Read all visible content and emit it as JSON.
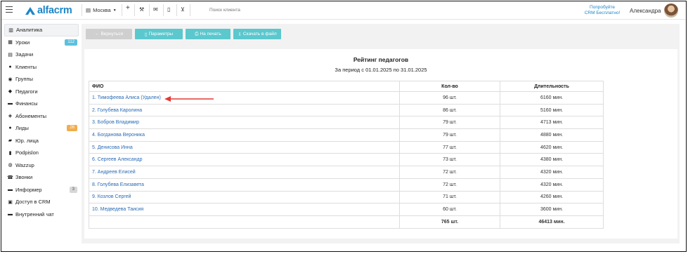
{
  "topbar": {
    "logo_text": "alfacrm",
    "branch": "Москва",
    "search_placeholder": "Поиск клиента",
    "promo_line1": "Попробуйте",
    "promo_line2": "CRM Бесплатно!",
    "user_name": "Александра"
  },
  "sidebar": {
    "items": [
      {
        "label": "Аналитика",
        "icon": "chart-icon"
      },
      {
        "label": "Уроки",
        "icon": "calendar-icon",
        "badge": "112"
      },
      {
        "label": "Задачи",
        "icon": "tasks-icon"
      },
      {
        "label": "Клиенты",
        "icon": "user-icon"
      },
      {
        "label": "Группы",
        "icon": "users-icon"
      },
      {
        "label": "Педагоги",
        "icon": "graduation-icon"
      },
      {
        "label": "Финансы",
        "icon": "money-icon"
      },
      {
        "label": "Абонементы",
        "icon": "tag-icon"
      },
      {
        "label": "Лиды",
        "icon": "user-plus-icon",
        "badge": "26"
      },
      {
        "label": "Юр. лица",
        "icon": "briefcase-icon"
      },
      {
        "label": "Podpislon",
        "icon": "file-icon"
      },
      {
        "label": "Wazzup",
        "icon": "whatsapp-icon"
      },
      {
        "label": "Звонки",
        "icon": "phone-icon"
      },
      {
        "label": "Информер",
        "icon": "bell-icon",
        "badge": "3"
      },
      {
        "label": "Доступ в CRM",
        "icon": "lock-icon"
      },
      {
        "label": "Внутренний чат",
        "icon": "chat-icon"
      }
    ],
    "badge_colors": {
      "blue": "#5bc0de",
      "orange": "#f0ad4e",
      "gray": "#d7d7d7"
    }
  },
  "toolbar": {
    "back_label": "Вернуться",
    "params_label": "Параметры",
    "print_label": "На печать",
    "download_label": "Скачать в файл"
  },
  "report": {
    "title": "Рейтинг педагогов",
    "period": "За период с 01.01.2025 по 31.01.2025",
    "columns": [
      "ФИО",
      "Кол-во",
      "Длительность"
    ],
    "rows": [
      {
        "name": "1. Тимофеева Алиса (Удален)",
        "count": "96 шт.",
        "duration": "6160 мин."
      },
      {
        "name": "2. Голубева Каролина",
        "count": "86 шт.",
        "duration": "5160 мин."
      },
      {
        "name": "3. Бобров Владимир",
        "count": "79 шт.",
        "duration": "4713 мин."
      },
      {
        "name": "4. Богданова Вероника",
        "count": "79 шт.",
        "duration": "4880 мин."
      },
      {
        "name": "5. Денисова Инна",
        "count": "77 шт.",
        "duration": "4620 мин."
      },
      {
        "name": "6. Сергеев Александр",
        "count": "73 шт.",
        "duration": "4380 мин."
      },
      {
        "name": "7. Андреев Елисей",
        "count": "72 шт.",
        "duration": "4320 мин."
      },
      {
        "name": "8. Голубева Елизавета",
        "count": "72 шт.",
        "duration": "4320 мин."
      },
      {
        "name": "9. Козлов Сергей",
        "count": "71 шт.",
        "duration": "4260 мин."
      },
      {
        "name": "10. Медведева Таисия",
        "count": "60 шт.",
        "duration": "3600 мин."
      }
    ],
    "total_count": "765 шт.",
    "total_duration": "46413 мин."
  },
  "colors": {
    "accent": "#1d86c9",
    "teal": "#5bc8ce",
    "link": "#2a6bb5",
    "annotation_arrow": "#e53935"
  }
}
